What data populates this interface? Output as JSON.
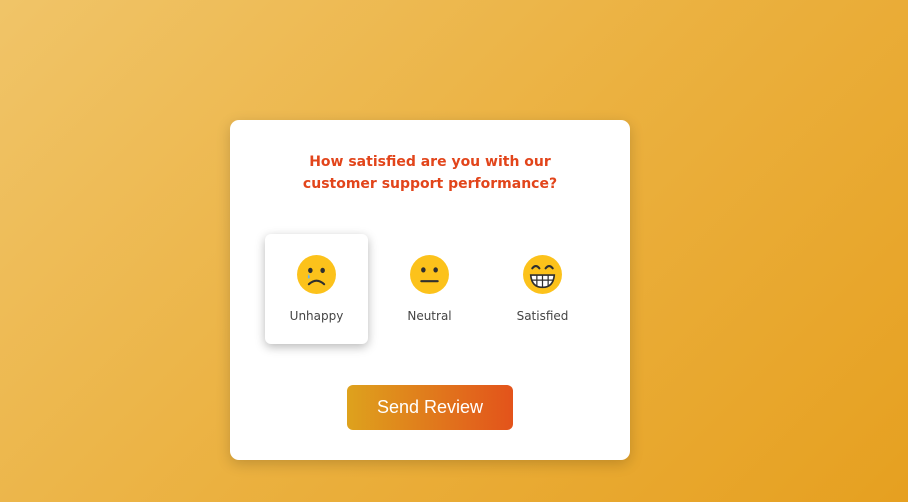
{
  "question": {
    "line1": "How satisfied are you with our",
    "line2": "customer support performance?"
  },
  "ratings": [
    {
      "label": "Unhappy",
      "icon": "unhappy-face-icon",
      "selected": true
    },
    {
      "label": "Neutral",
      "icon": "neutral-face-icon",
      "selected": false
    },
    {
      "label": "Satisfied",
      "icon": "grinning-face-icon",
      "selected": false
    }
  ],
  "send_button": {
    "label": "Send Review"
  },
  "colors": {
    "accent": "#e2451b",
    "emoji_yellow": "#fcc21b",
    "tear": "#64b5f6",
    "button_start": "#dea21d",
    "button_end": "#e3531b"
  }
}
